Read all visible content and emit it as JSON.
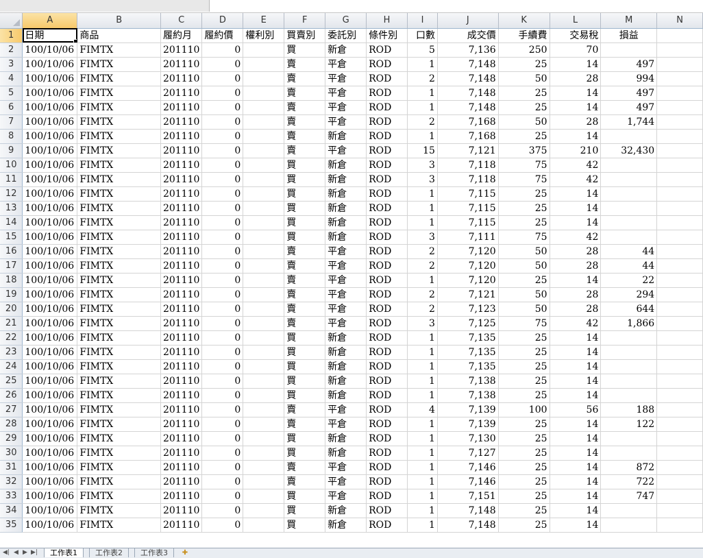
{
  "columns": [
    "A",
    "B",
    "C",
    "D",
    "E",
    "F",
    "G",
    "H",
    "I",
    "J",
    "K",
    "L",
    "M",
    "N"
  ],
  "header_row": [
    "日期",
    "商品",
    "履約月",
    "履約價",
    "權利別",
    "買賣別",
    "委託別",
    "條件別",
    "口數",
    "成交價",
    "手續費",
    "交易稅",
    "損益"
  ],
  "rows": [
    {
      "n": "2",
      "c": [
        "100/10/06",
        "FIMTX",
        "201110",
        "0",
        "",
        "買",
        "新倉",
        "ROD",
        "5",
        "7,136",
        "250",
        "70",
        ""
      ]
    },
    {
      "n": "3",
      "c": [
        "100/10/06",
        "FIMTX",
        "201110",
        "0",
        "",
        "賣",
        "平倉",
        "ROD",
        "1",
        "7,148",
        "25",
        "14",
        "497"
      ]
    },
    {
      "n": "4",
      "c": [
        "100/10/06",
        "FIMTX",
        "201110",
        "0",
        "",
        "賣",
        "平倉",
        "ROD",
        "2",
        "7,148",
        "50",
        "28",
        "994"
      ]
    },
    {
      "n": "5",
      "c": [
        "100/10/06",
        "FIMTX",
        "201110",
        "0",
        "",
        "賣",
        "平倉",
        "ROD",
        "1",
        "7,148",
        "25",
        "14",
        "497"
      ]
    },
    {
      "n": "6",
      "c": [
        "100/10/06",
        "FIMTX",
        "201110",
        "0",
        "",
        "賣",
        "平倉",
        "ROD",
        "1",
        "7,148",
        "25",
        "14",
        "497"
      ]
    },
    {
      "n": "7",
      "c": [
        "100/10/06",
        "FIMTX",
        "201110",
        "0",
        "",
        "賣",
        "平倉",
        "ROD",
        "2",
        "7,168",
        "50",
        "28",
        "1,744"
      ]
    },
    {
      "n": "8",
      "c": [
        "100/10/06",
        "FIMTX",
        "201110",
        "0",
        "",
        "賣",
        "新倉",
        "ROD",
        "1",
        "7,168",
        "25",
        "14",
        ""
      ]
    },
    {
      "n": "9",
      "c": [
        "100/10/06",
        "FIMTX",
        "201110",
        "0",
        "",
        "賣",
        "平倉",
        "ROD",
        "15",
        "7,121",
        "375",
        "210",
        "32,430"
      ]
    },
    {
      "n": "10",
      "c": [
        "100/10/06",
        "FIMTX",
        "201110",
        "0",
        "",
        "買",
        "新倉",
        "ROD",
        "3",
        "7,118",
        "75",
        "42",
        ""
      ]
    },
    {
      "n": "11",
      "c": [
        "100/10/06",
        "FIMTX",
        "201110",
        "0",
        "",
        "買",
        "新倉",
        "ROD",
        "3",
        "7,118",
        "75",
        "42",
        ""
      ]
    },
    {
      "n": "12",
      "c": [
        "100/10/06",
        "FIMTX",
        "201110",
        "0",
        "",
        "買",
        "新倉",
        "ROD",
        "1",
        "7,115",
        "25",
        "14",
        ""
      ]
    },
    {
      "n": "13",
      "c": [
        "100/10/06",
        "FIMTX",
        "201110",
        "0",
        "",
        "買",
        "新倉",
        "ROD",
        "1",
        "7,115",
        "25",
        "14",
        ""
      ]
    },
    {
      "n": "14",
      "c": [
        "100/10/06",
        "FIMTX",
        "201110",
        "0",
        "",
        "買",
        "新倉",
        "ROD",
        "1",
        "7,115",
        "25",
        "14",
        ""
      ]
    },
    {
      "n": "15",
      "c": [
        "100/10/06",
        "FIMTX",
        "201110",
        "0",
        "",
        "買",
        "新倉",
        "ROD",
        "3",
        "7,111",
        "75",
        "42",
        ""
      ]
    },
    {
      "n": "16",
      "c": [
        "100/10/06",
        "FIMTX",
        "201110",
        "0",
        "",
        "賣",
        "平倉",
        "ROD",
        "2",
        "7,120",
        "50",
        "28",
        "44"
      ]
    },
    {
      "n": "17",
      "c": [
        "100/10/06",
        "FIMTX",
        "201110",
        "0",
        "",
        "賣",
        "平倉",
        "ROD",
        "2",
        "7,120",
        "50",
        "28",
        "44"
      ]
    },
    {
      "n": "18",
      "c": [
        "100/10/06",
        "FIMTX",
        "201110",
        "0",
        "",
        "賣",
        "平倉",
        "ROD",
        "1",
        "7,120",
        "25",
        "14",
        "22"
      ]
    },
    {
      "n": "19",
      "c": [
        "100/10/06",
        "FIMTX",
        "201110",
        "0",
        "",
        "賣",
        "平倉",
        "ROD",
        "2",
        "7,121",
        "50",
        "28",
        "294"
      ]
    },
    {
      "n": "20",
      "c": [
        "100/10/06",
        "FIMTX",
        "201110",
        "0",
        "",
        "賣",
        "平倉",
        "ROD",
        "2",
        "7,123",
        "50",
        "28",
        "644"
      ]
    },
    {
      "n": "21",
      "c": [
        "100/10/06",
        "FIMTX",
        "201110",
        "0",
        "",
        "賣",
        "平倉",
        "ROD",
        "3",
        "7,125",
        "75",
        "42",
        "1,866"
      ]
    },
    {
      "n": "22",
      "c": [
        "100/10/06",
        "FIMTX",
        "201110",
        "0",
        "",
        "買",
        "新倉",
        "ROD",
        "1",
        "7,135",
        "25",
        "14",
        ""
      ]
    },
    {
      "n": "23",
      "c": [
        "100/10/06",
        "FIMTX",
        "201110",
        "0",
        "",
        "買",
        "新倉",
        "ROD",
        "1",
        "7,135",
        "25",
        "14",
        ""
      ]
    },
    {
      "n": "24",
      "c": [
        "100/10/06",
        "FIMTX",
        "201110",
        "0",
        "",
        "買",
        "新倉",
        "ROD",
        "1",
        "7,135",
        "25",
        "14",
        ""
      ]
    },
    {
      "n": "25",
      "c": [
        "100/10/06",
        "FIMTX",
        "201110",
        "0",
        "",
        "買",
        "新倉",
        "ROD",
        "1",
        "7,138",
        "25",
        "14",
        ""
      ]
    },
    {
      "n": "26",
      "c": [
        "100/10/06",
        "FIMTX",
        "201110",
        "0",
        "",
        "買",
        "新倉",
        "ROD",
        "1",
        "7,138",
        "25",
        "14",
        ""
      ]
    },
    {
      "n": "27",
      "c": [
        "100/10/06",
        "FIMTX",
        "201110",
        "0",
        "",
        "賣",
        "平倉",
        "ROD",
        "4",
        "7,139",
        "100",
        "56",
        "188"
      ]
    },
    {
      "n": "28",
      "c": [
        "100/10/06",
        "FIMTX",
        "201110",
        "0",
        "",
        "賣",
        "平倉",
        "ROD",
        "1",
        "7,139",
        "25",
        "14",
        "122"
      ]
    },
    {
      "n": "29",
      "c": [
        "100/10/06",
        "FIMTX",
        "201110",
        "0",
        "",
        "買",
        "新倉",
        "ROD",
        "1",
        "7,130",
        "25",
        "14",
        ""
      ]
    },
    {
      "n": "30",
      "c": [
        "100/10/06",
        "FIMTX",
        "201110",
        "0",
        "",
        "買",
        "新倉",
        "ROD",
        "1",
        "7,127",
        "25",
        "14",
        ""
      ]
    },
    {
      "n": "31",
      "c": [
        "100/10/06",
        "FIMTX",
        "201110",
        "0",
        "",
        "賣",
        "平倉",
        "ROD",
        "1",
        "7,146",
        "25",
        "14",
        "872"
      ]
    },
    {
      "n": "32",
      "c": [
        "100/10/06",
        "FIMTX",
        "201110",
        "0",
        "",
        "賣",
        "平倉",
        "ROD",
        "1",
        "7,146",
        "25",
        "14",
        "722"
      ]
    },
    {
      "n": "33",
      "c": [
        "100/10/06",
        "FIMTX",
        "201110",
        "0",
        "",
        "買",
        "平倉",
        "ROD",
        "1",
        "7,151",
        "25",
        "14",
        "747"
      ]
    },
    {
      "n": "34",
      "c": [
        "100/10/06",
        "FIMTX",
        "201110",
        "0",
        "",
        "買",
        "新倉",
        "ROD",
        "1",
        "7,148",
        "25",
        "14",
        ""
      ]
    },
    {
      "n": "35",
      "c": [
        "100/10/06",
        "FIMTX",
        "201110",
        "0",
        "",
        "買",
        "新倉",
        "ROD",
        "1",
        "7,148",
        "25",
        "14",
        ""
      ]
    }
  ],
  "sheet_tabs": [
    "工作表1",
    "工作表2",
    "工作表3"
  ],
  "nav_icons": [
    "first-sheet-icon",
    "prev-sheet-icon",
    "next-sheet-icon",
    "last-sheet-icon"
  ],
  "colors": {
    "header_bg": "#e2e6ec",
    "selected_header": "#f7c96b",
    "grid_line": "#d4d4d4"
  }
}
